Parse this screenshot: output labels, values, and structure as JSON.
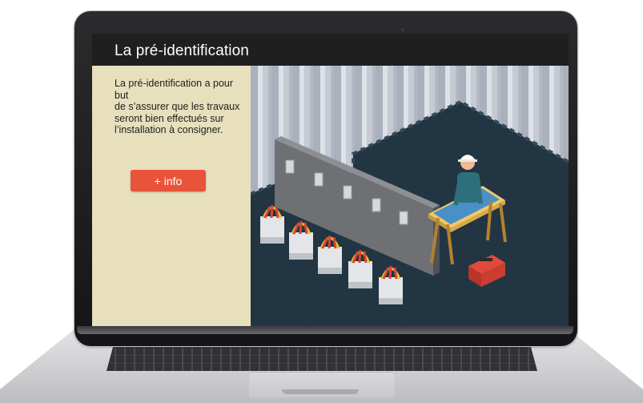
{
  "header": {
    "title": "La pré-identification"
  },
  "panel": {
    "description_lines": [
      "La pré-identification a pour but",
      "de s’assurer que les travaux",
      "seront bien effectués sur",
      "l’installation à consigner."
    ],
    "info_button_label": "+ info"
  },
  "colors": {
    "titlebar": "#1f1f20",
    "panel_bg": "#e8e0bd",
    "accent": "#e8543a",
    "floor": "#223542",
    "curtain": "#b9bfca"
  },
  "illustration": {
    "subject": "worker-at-workbench",
    "icons": [
      "hard-hat-worker-icon",
      "blueprint-table-icon",
      "red-toolbox-icon",
      "electrical-cabinets-icon"
    ]
  }
}
